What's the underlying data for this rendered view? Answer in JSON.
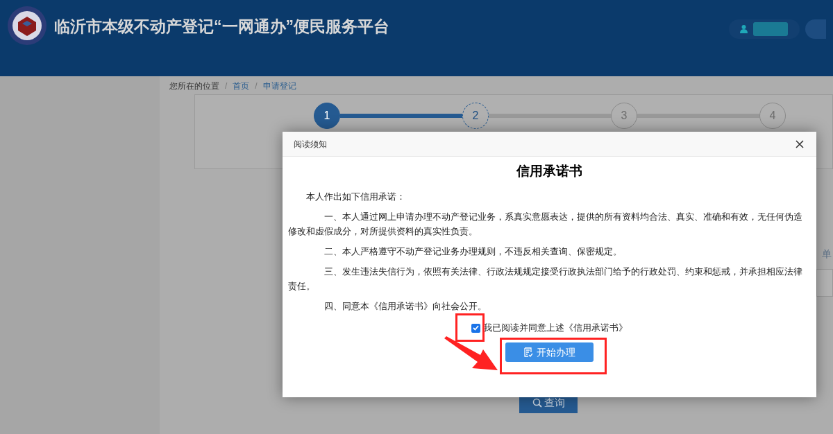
{
  "header": {
    "title": "临沂市本级不动产登记“一网通办”便民服务平台"
  },
  "breadcrumb": {
    "separator": "/",
    "items": [
      "您所在的位置",
      "首页",
      "申请登记"
    ]
  },
  "steps": [
    {
      "label": "1",
      "completed": true,
      "selected": false
    },
    {
      "label": "2",
      "completed": false,
      "selected": true
    },
    {
      "label": "3",
      "completed": false,
      "selected": false
    },
    {
      "label": "4",
      "completed": false,
      "selected": false
    }
  ],
  "background": {
    "side_text": "单",
    "search_button": "查询"
  },
  "dialog": {
    "title": "阅读须知",
    "heading": "信用承诺书",
    "intro": "本人作出如下信用承诺：",
    "paragraphs": [
      "一、本人通过网上申请办理不动产登记业务，系真实意愿表达，提供的所有资料均合法、真实、准确和有效，无任何伪造修改和虚假成分，对所提供资料的真实性负责。",
      "二、本人严格遵守不动产登记业务办理规则，不违反相关查询、保密规定。",
      "三、发生违法失信行为，依照有关法律、行政法规规定接受行政执法部门给予的行政处罚、约束和惩戒，并承担相应法律责任。",
      "四、同意本《信用承诺书》向社会公开。"
    ],
    "agree": {
      "label": "我已阅读并同意上述《信用承诺书》",
      "checked": true
    },
    "start_button": "开始办理"
  }
}
